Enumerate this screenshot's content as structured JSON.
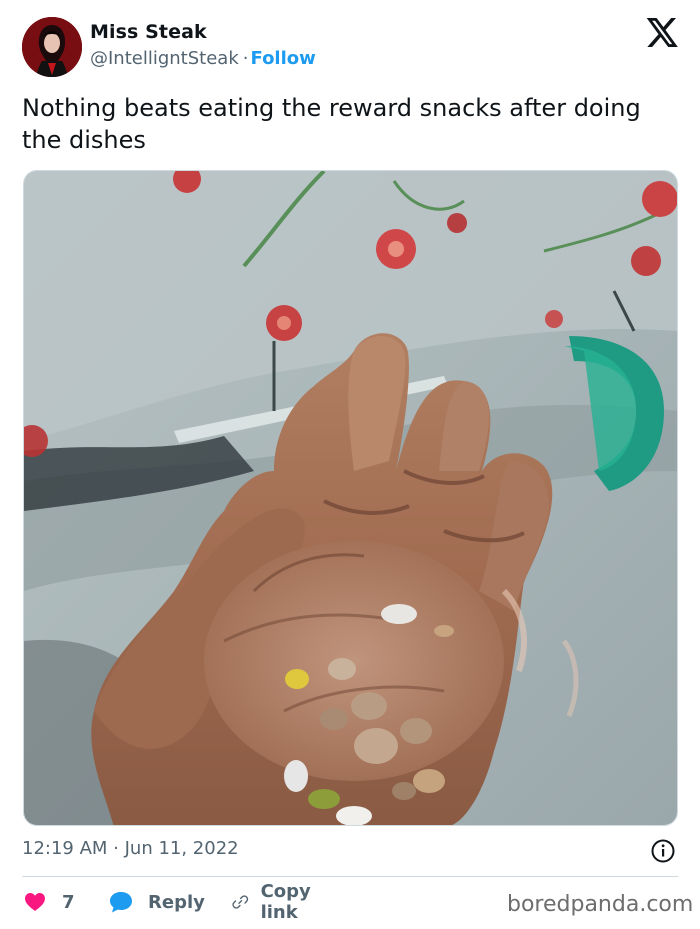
{
  "author": {
    "display_name": "Miss Steak",
    "handle": "@IntelligntSteak",
    "separator": "·",
    "follow_label": "Follow",
    "avatar_icon": "profile-avatar"
  },
  "platform_icon": "x-logo",
  "tweet": {
    "text": "Nothing beats eating the reward snacks after doing the dishes",
    "timestamp": "12:19 AM · Jun 11, 2022"
  },
  "actions": {
    "like_count": "7",
    "reply_label": "Reply",
    "copy_link_label": "Copy link"
  },
  "watermark": "boredpanda.com",
  "colors": {
    "accent": "#1d9bf0",
    "like": "#f91880",
    "text_primary": "#0f1419",
    "text_secondary": "#536471",
    "border": "#cfd9de"
  }
}
